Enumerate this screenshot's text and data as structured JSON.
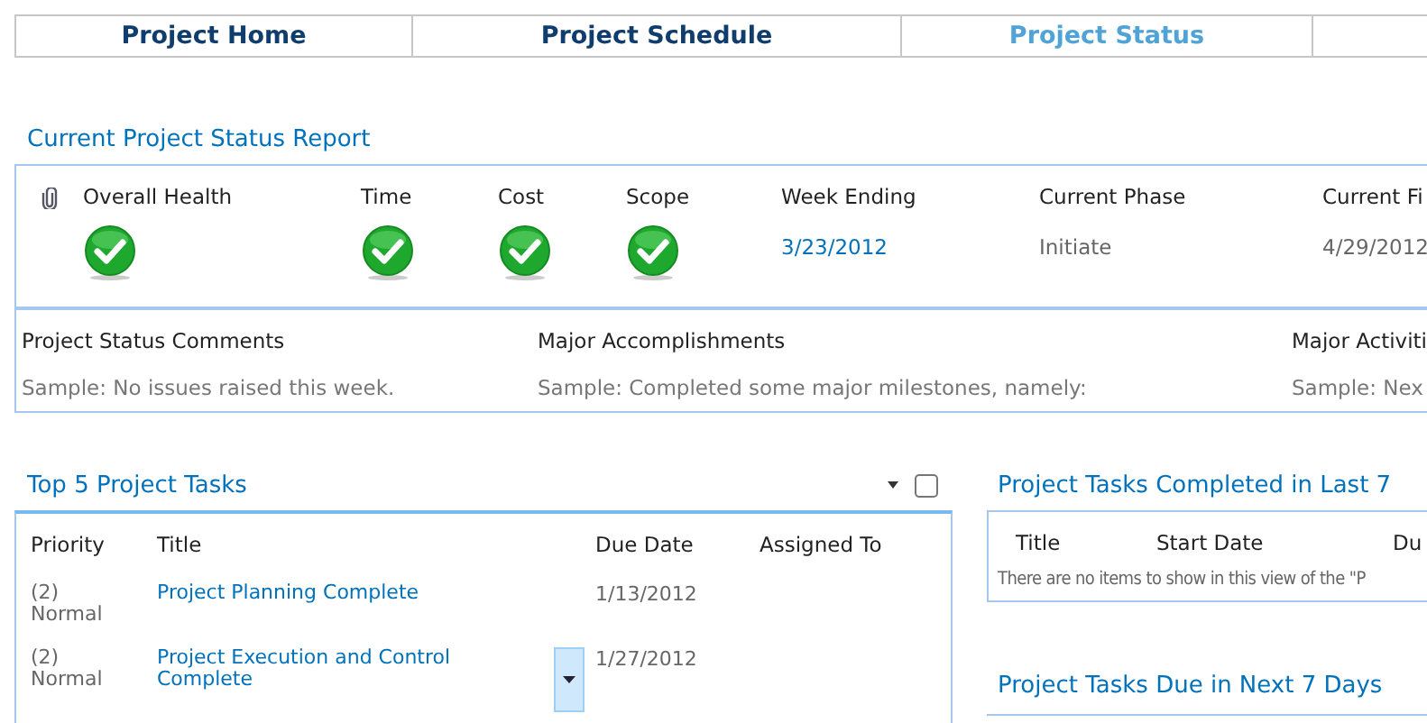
{
  "tabs": [
    {
      "label": "Project Home",
      "selected": false
    },
    {
      "label": "Project Schedule",
      "selected": false
    },
    {
      "label": "Project Status",
      "selected": true
    }
  ],
  "status_report": {
    "title": "Current Project Status Report",
    "indicators": [
      {
        "label": "Overall Health",
        "kind": "health"
      },
      {
        "label": "Time",
        "kind": "health"
      },
      {
        "label": "Cost",
        "kind": "health"
      },
      {
        "label": "Scope",
        "kind": "health"
      },
      {
        "label": "Week Ending",
        "kind": "link",
        "value": "3/23/2012"
      },
      {
        "label": "Current Phase",
        "kind": "text",
        "value": "Initiate"
      },
      {
        "label": "Current Fi",
        "kind": "text",
        "value": "4/29/2012"
      }
    ],
    "comments": [
      {
        "label": "Project Status Comments",
        "value": "Sample: No issues raised this week."
      },
      {
        "label": "Major Accomplishments",
        "value": "Sample: Completed some major milestones, namely:"
      },
      {
        "label": "Major Activiti",
        "value": "Sample: Nex"
      }
    ]
  },
  "top_tasks": {
    "title": "Top 5 Project Tasks",
    "checked": false,
    "columns": [
      "Priority",
      "Title",
      "Due Date",
      "Assigned To"
    ],
    "rows": [
      {
        "priority": "(2) Normal",
        "title": "Project Planning Complete",
        "due": "1/13/2012",
        "selected": false
      },
      {
        "priority": "(2) Normal",
        "title": "Project Execution and Control Complete",
        "due": "1/27/2012",
        "selected": true
      }
    ]
  },
  "completed_tasks": {
    "title": "Project Tasks Completed in Last 7",
    "columns": [
      "Title",
      "Start Date",
      "Du"
    ],
    "empty_message": "There are no items to show in this view of the \"P"
  },
  "due_tasks": {
    "title": "Project Tasks Due in Next 7 Days"
  }
}
